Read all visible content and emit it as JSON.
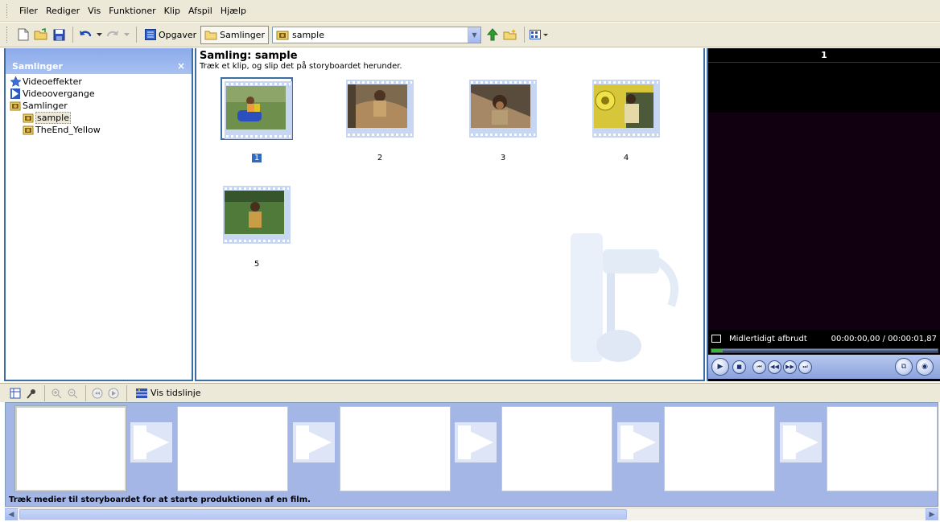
{
  "menu": [
    "Filer",
    "Rediger",
    "Vis",
    "Funktioner",
    "Klip",
    "Afspil",
    "Hjælp"
  ],
  "toolbar": {
    "tasks_label": "Opgaver",
    "collections_label": "Samlinger",
    "collection_select_value": "sample"
  },
  "collections_panel": {
    "title": "Samlinger",
    "close": "×",
    "tree": [
      {
        "label": "Videoeffekter",
        "icon": "star-icon"
      },
      {
        "label": "Videoovergange",
        "icon": "transition-icon"
      },
      {
        "label": "Samlinger",
        "icon": "collection-icon"
      },
      {
        "label": "sample",
        "icon": "collection-icon",
        "selected": true
      },
      {
        "label": "TheEnd_Yellow",
        "icon": "collection-icon"
      }
    ]
  },
  "content": {
    "title": "Samling: sample",
    "subtitle": "Træk et klip, og slip det på storyboardet herunder.",
    "clips": [
      {
        "label": "1",
        "selected": true
      },
      {
        "label": "2"
      },
      {
        "label": "3"
      },
      {
        "label": "4"
      },
      {
        "label": "5"
      }
    ]
  },
  "preview": {
    "clip_number": "1",
    "status": "Midlertidigt afbrudt",
    "time": "00:00:00,00 / 00:00:01,87",
    "progress": 0.05
  },
  "storyboard": {
    "show_timeline_label": "Vis tidslinje",
    "hint": "Træk medier til storyboardet for at starte produktionen af en film."
  },
  "colors": {
    "accent": "#3a6ea5",
    "panel_header": "#8caaea",
    "storyboard_bg": "#a4b6e6"
  }
}
